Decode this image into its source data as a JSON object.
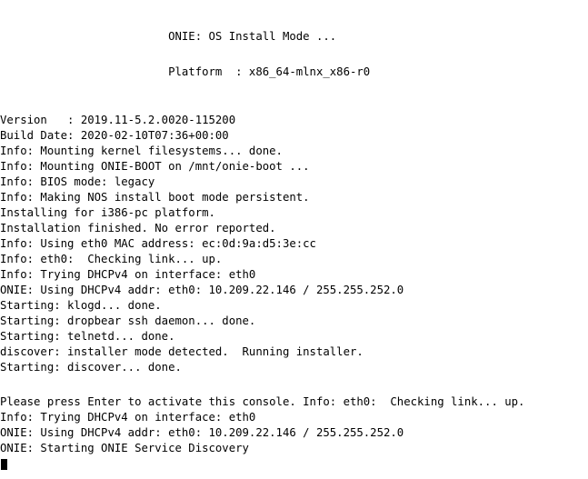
{
  "console": {
    "lines": [
      "                         ONIE: OS Install Mode ...",
      "                         Platform  : x86_64-mlnx_x86-r0",
      "Version   : 2019.11-5.2.0020-115200",
      "Build Date: 2020-02-10T07:36+00:00",
      "Info: Mounting kernel filesystems... done.",
      "Info: Mounting ONIE-BOOT on /mnt/onie-boot ...",
      "Info: BIOS mode: legacy",
      "Info: Making NOS install boot mode persistent.",
      "Installing for i386-pc platform.",
      "Installation finished. No error reported.",
      "Info: Using eth0 MAC address: ec:0d:9a:d5:3e:cc",
      "Info: eth0:  Checking link... up.",
      "Info: Trying DHCPv4 on interface: eth0",
      "ONIE: Using DHCPv4 addr: eth0: 10.209.22.146 / 255.255.252.0",
      "Starting: klogd... done.",
      "Starting: dropbear ssh daemon... done.",
      "Starting: telnetd... done.",
      "discover: installer mode detected.  Running installer.",
      "Starting: discover... done.",
      "Please press Enter to activate this console. Info: eth0:  Checking link... up.",
      "Info: Trying DHCPv4 on interface: eth0",
      "ONIE: Using DHCPv4 addr: eth0: 10.209.22.146 / 255.255.252.0",
      "ONIE: Starting ONIE Service Discovery"
    ]
  }
}
